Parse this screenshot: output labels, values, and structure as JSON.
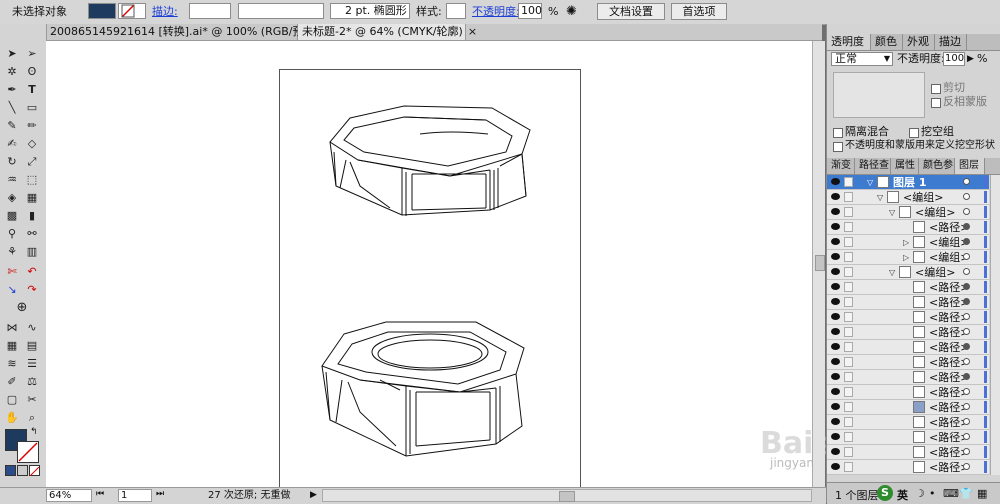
{
  "control_bar": {
    "selection_label": "未选择对象",
    "stroke_label": "描边:",
    "stroke_profile": "2 pt. 椭圆形",
    "style_label": "样式:",
    "opacity_label": "不透明度:",
    "opacity_value": "100",
    "opacity_unit": "%",
    "document_setup_button": "文档设置",
    "preferences_button": "首选项",
    "fill_color": "#1f3a5f"
  },
  "doc_tabs": [
    {
      "title": "200865145921614 [转换].ai* @ 100% (RGB/预览)",
      "close": "×"
    },
    {
      "title": "未标题-2* @ 64% (CMYK/轮廓)",
      "close": "×"
    }
  ],
  "status_bar": {
    "zoom": "64%",
    "artboard": "1",
    "undo_info": "27 次还原; 无重做"
  },
  "transparency_panel": {
    "tabs": [
      "透明度",
      "颜色",
      "外观",
      "描边"
    ],
    "blend_mode": "正常",
    "opacity_label": "不透明度:",
    "opacity_value": "100",
    "opacity_unit": "%",
    "clip_label": "剪切",
    "invert_mask_label": "反相蒙版",
    "isolate_blending_label": "隔离混合",
    "knockout_group_label": "挖空组",
    "opacity_mask_label": "不透明度和蒙版用来定义挖空形状"
  },
  "layers_panel": {
    "tabs": [
      "渐变",
      "路径查",
      "属性",
      "颜色参",
      "图层"
    ],
    "layer_name": "图层 1",
    "group_label": "<编组>",
    "path_label": "<路径>",
    "footer_label": "1 个图层",
    "rows": [
      {
        "label": "图层 1",
        "indent": 0,
        "type": "layer",
        "expanded": true
      },
      {
        "label": "<编组>",
        "indent": 1,
        "type": "group",
        "expanded": true
      },
      {
        "label": "<编组>",
        "indent": 2,
        "type": "group",
        "expanded": true
      },
      {
        "label": "<路径>",
        "indent": 3,
        "type": "path"
      },
      {
        "label": "<编组>",
        "indent": 3,
        "type": "group",
        "expanded": false
      },
      {
        "label": "<编组>",
        "indent": 3,
        "type": "group",
        "expanded": false
      },
      {
        "label": "<编组>",
        "indent": 2,
        "type": "group",
        "expanded": true
      },
      {
        "label": "<路径>",
        "indent": 3,
        "type": "path"
      },
      {
        "label": "<路径>",
        "indent": 3,
        "type": "path"
      },
      {
        "label": "<路径>",
        "indent": 3,
        "type": "path"
      },
      {
        "label": "<路径>",
        "indent": 3,
        "type": "path"
      },
      {
        "label": "<路径>",
        "indent": 3,
        "type": "path"
      },
      {
        "label": "<路径>",
        "indent": 3,
        "type": "path"
      },
      {
        "label": "<路径>",
        "indent": 3,
        "type": "path"
      },
      {
        "label": "<路径>",
        "indent": 3,
        "type": "path"
      },
      {
        "label": "<路径>",
        "indent": 3,
        "type": "path"
      },
      {
        "label": "<路径>",
        "indent": 3,
        "type": "path"
      },
      {
        "label": "<路径>",
        "indent": 3,
        "type": "path"
      },
      {
        "label": "<路径>",
        "indent": 3,
        "type": "path"
      },
      {
        "label": "<路径>",
        "indent": 3,
        "type": "path"
      }
    ]
  },
  "watermark": {
    "brand": "Bai 经验",
    "url": "jingyan.baidu.com"
  },
  "ime": {
    "s_label": "S",
    "lang_label": "英"
  }
}
